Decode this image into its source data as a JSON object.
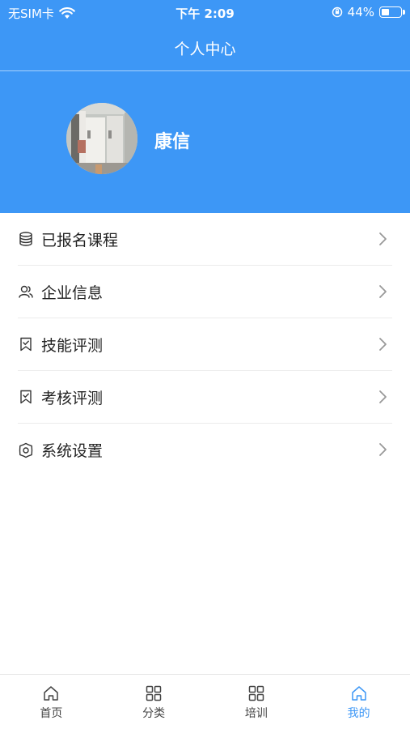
{
  "status_bar": {
    "carrier": "无SIM卡",
    "time": "下午 2:09",
    "battery": "44%",
    "battery_level": 0.44,
    "icons": [
      "wifi-icon",
      "orientation-lock-icon",
      "battery-icon"
    ]
  },
  "nav": {
    "title": "个人中心"
  },
  "profile": {
    "name": "康信"
  },
  "menu": {
    "items": [
      {
        "label": "已报名课程",
        "icon": "database-icon"
      },
      {
        "label": "企业信息",
        "icon": "users-icon"
      },
      {
        "label": "技能评测",
        "icon": "bookmark-icon"
      },
      {
        "label": "考核评测",
        "icon": "bookmark-icon"
      },
      {
        "label": "系统设置",
        "icon": "gear-icon"
      }
    ]
  },
  "tabbar": {
    "tabs": [
      {
        "label": "首页",
        "icon": "home-icon",
        "active": false
      },
      {
        "label": "分类",
        "icon": "grid-icon",
        "active": false
      },
      {
        "label": "培训",
        "icon": "grid-icon",
        "active": false
      },
      {
        "label": "我的",
        "icon": "home-icon",
        "active": true
      }
    ]
  },
  "colors": {
    "primary": "#3d97f6",
    "text": "#222222",
    "divider": "#ececec"
  }
}
